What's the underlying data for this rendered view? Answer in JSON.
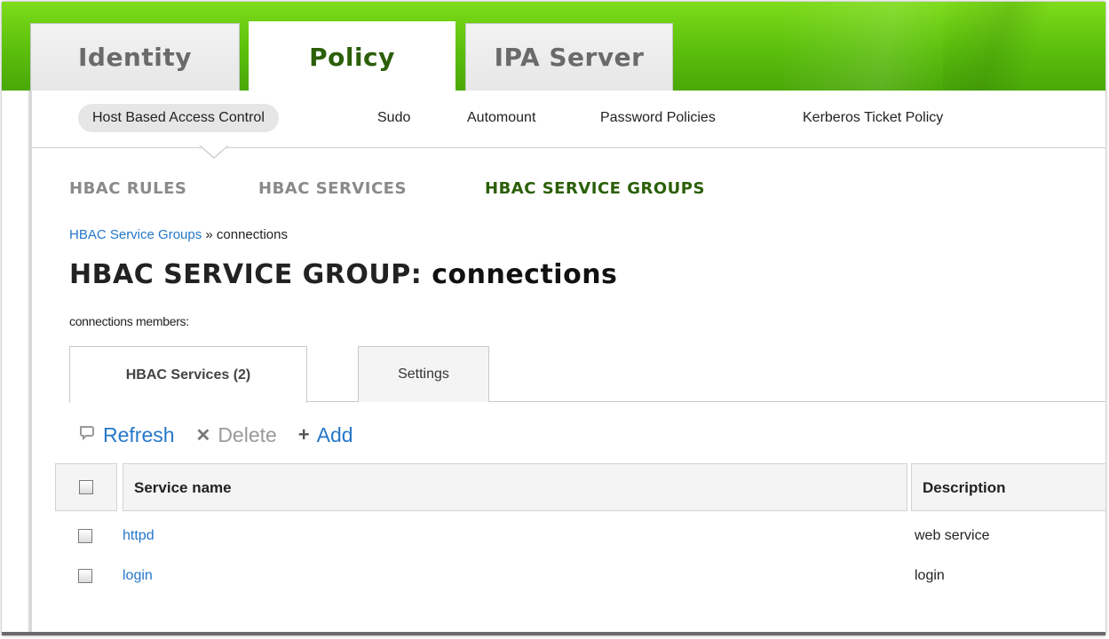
{
  "nav": {
    "top_tabs": [
      {
        "label": "Identity"
      },
      {
        "label": "Policy",
        "active": true
      },
      {
        "label": "IPA Server"
      }
    ],
    "sub_tabs": [
      {
        "label": "Host Based Access Control",
        "active": true
      },
      {
        "label": "Sudo"
      },
      {
        "label": "Automount"
      },
      {
        "label": "Password Policies"
      },
      {
        "label": "Kerberos Ticket Policy"
      }
    ],
    "facets": [
      {
        "label": "HBAC RULES"
      },
      {
        "label": "HBAC SERVICES"
      },
      {
        "label": "HBAC SERVICE GROUPS",
        "active": true
      }
    ]
  },
  "breadcrumb": {
    "link": "HBAC Service Groups",
    "separator": " » ",
    "current": "connections"
  },
  "page": {
    "title_prefix": "HBAC SERVICE GROUP:",
    "title_object": "connections",
    "members_label": "connections members:"
  },
  "section_tabs": [
    {
      "label": "HBAC Services (2)",
      "active": true
    },
    {
      "label": "Settings"
    }
  ],
  "toolbar": {
    "refresh_label": "Refresh",
    "delete_label": "Delete",
    "add_label": "Add",
    "icons": {
      "refresh": "refresh-icon",
      "delete": "x-icon",
      "add": "plus-icon"
    }
  },
  "table": {
    "columns": [
      "Service name",
      "Description"
    ],
    "rows": [
      {
        "name": "httpd",
        "description": "web service"
      },
      {
        "name": "login",
        "description": "login"
      }
    ]
  },
  "colors": {
    "accent_green": "#5bbf0c",
    "active_text": "#2b5f08",
    "link_blue": "#2577c9"
  }
}
